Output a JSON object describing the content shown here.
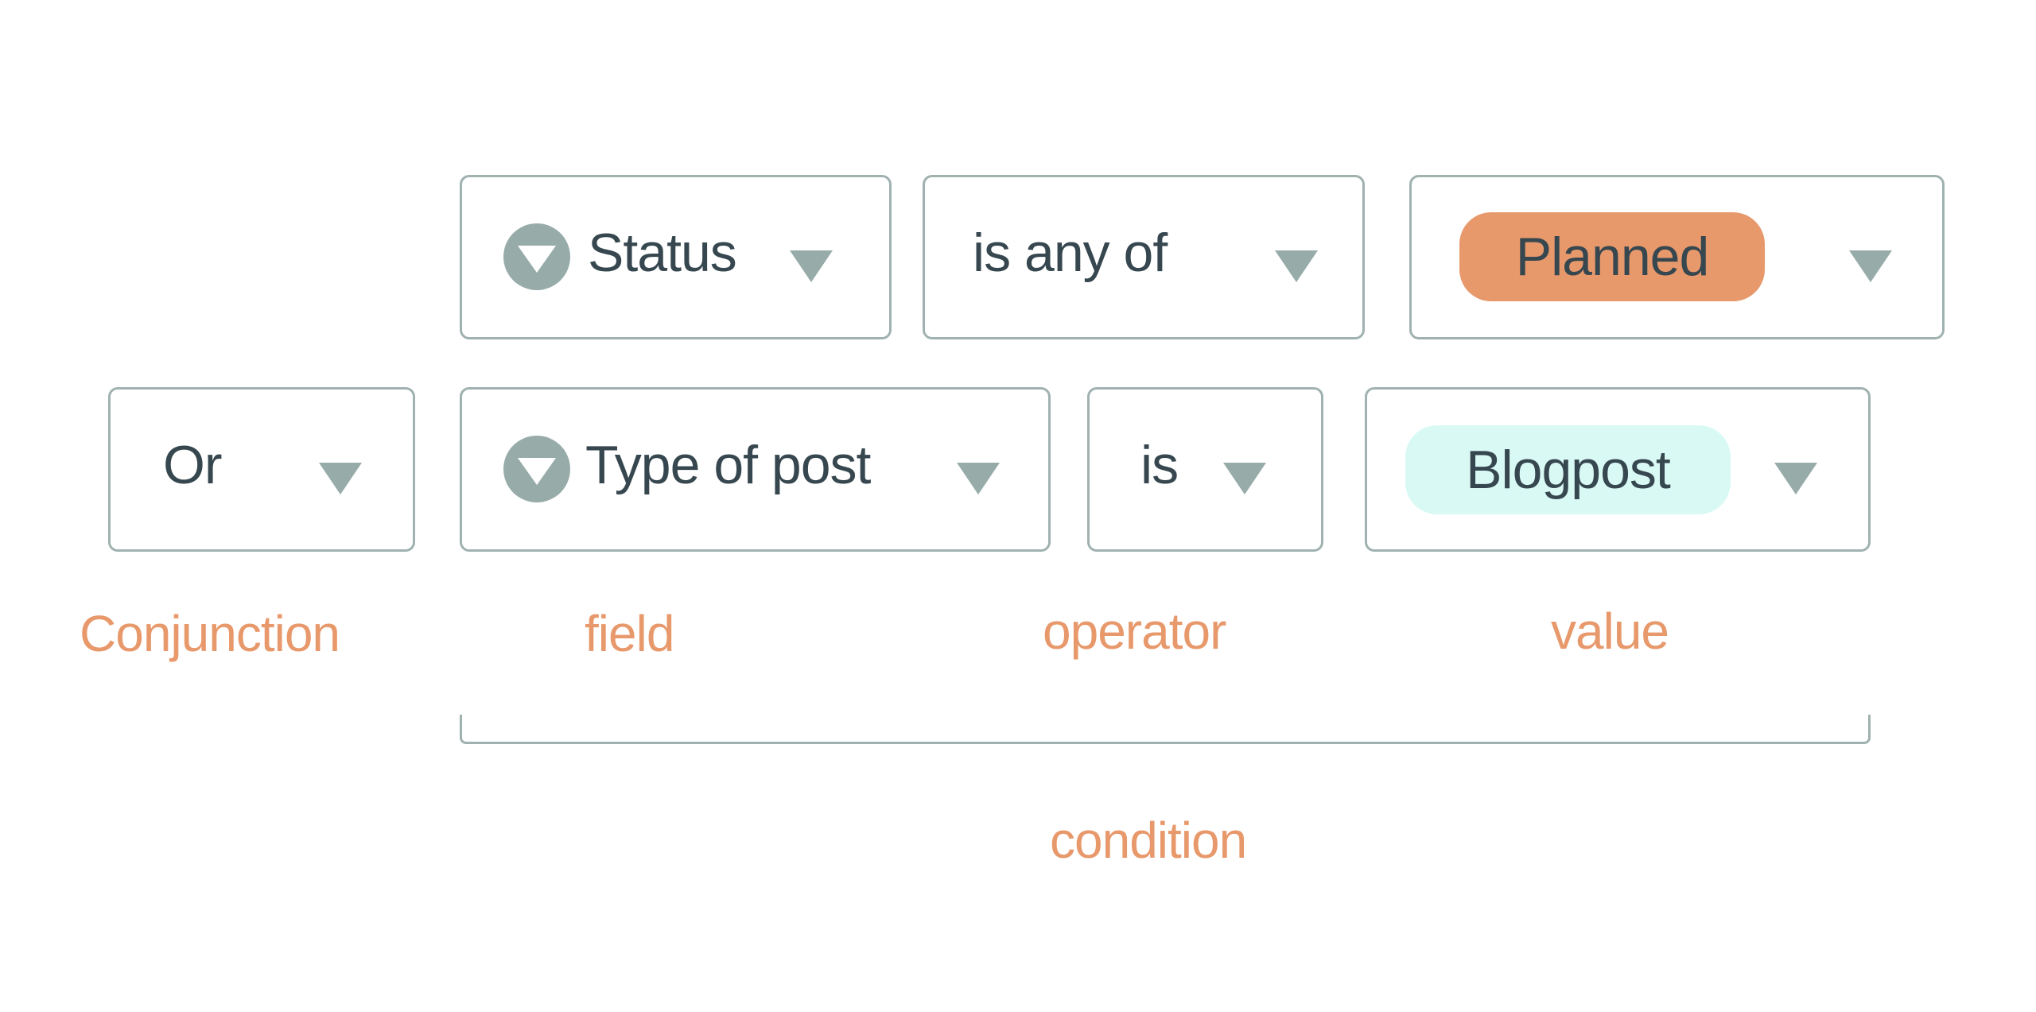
{
  "colors": {
    "label": "#e8996c",
    "text": "#37474f",
    "border": "#9fb2b0",
    "caret": "#97aca9",
    "planned_pill": "#e8996c",
    "blogpost_pill": "#d9f9f5"
  },
  "row1": {
    "field": {
      "icon": "dropdown-field-icon",
      "label": "Status"
    },
    "operator": {
      "label": "is any of"
    },
    "value": {
      "label": "Planned"
    }
  },
  "row2": {
    "conjunction": {
      "label": "Or"
    },
    "field": {
      "icon": "dropdown-field-icon",
      "label": "Type of post"
    },
    "operator": {
      "label": "is"
    },
    "value": {
      "label": "Blogpost"
    }
  },
  "annotations": {
    "conjunction": "Conjunction",
    "field": "field",
    "operator": "operator",
    "value": "value",
    "condition": "condition"
  }
}
